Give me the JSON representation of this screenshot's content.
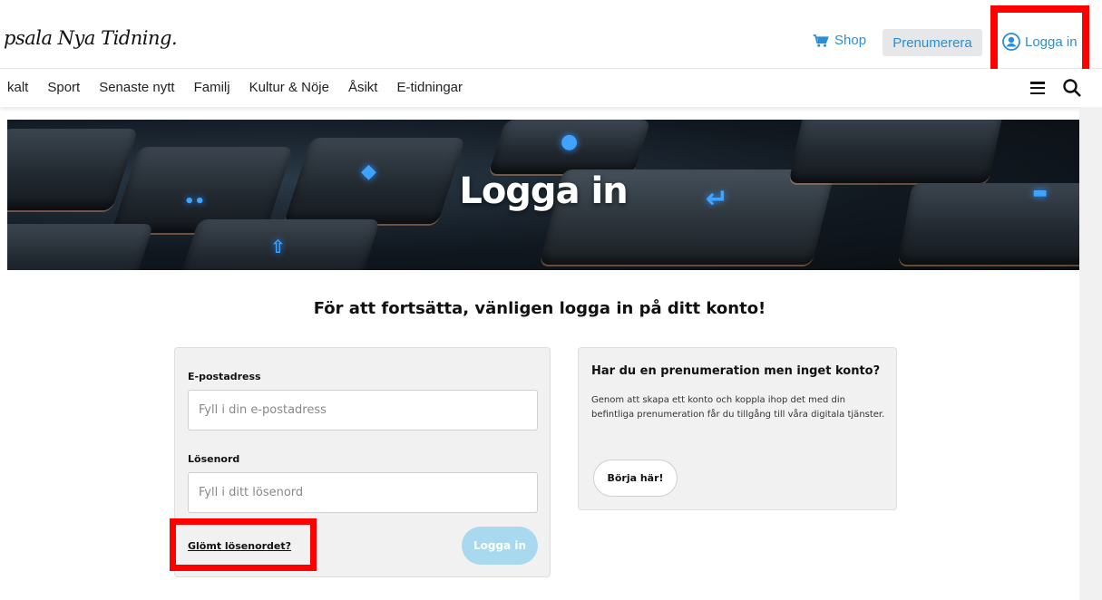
{
  "header": {
    "logo_text": "psala Nya Tidning.",
    "shop_label": "Shop",
    "subscribe_label": "Prenumerera",
    "login_label": "Logga in",
    "accent_color": "#2a8fd6"
  },
  "nav": {
    "items": [
      {
        "label": "kalt"
      },
      {
        "label": "Sport"
      },
      {
        "label": "Senaste nytt"
      },
      {
        "label": "Familj"
      },
      {
        "label": "Kultur & Nöje"
      },
      {
        "label": "Åsikt"
      },
      {
        "label": "E-tidningar"
      }
    ]
  },
  "hero": {
    "title": "Logga in"
  },
  "main": {
    "subtitle": "För att fortsätta, vänligen logga in på ditt konto!"
  },
  "login_form": {
    "email_label": "E-postadress",
    "email_placeholder": "Fyll i din e-postadress",
    "password_label": "Lösenord",
    "password_placeholder": "Fyll i ditt lösenord",
    "forgot_label": "Glömt lösenordet?",
    "submit_label": "Logga in"
  },
  "info_card": {
    "title": "Har du en prenumeration men inget konto?",
    "text": "Genom att skapa ett konto och koppla ihop det med din befintliga prenumeration får du tillgång till våra digitala tjänster.",
    "button_label": "Börja här!"
  },
  "icons": {
    "shop": "cart-icon",
    "login": "user-circle-icon",
    "menu": "hamburger-icon",
    "search": "search-icon"
  },
  "highlight_color": "#ff0000"
}
